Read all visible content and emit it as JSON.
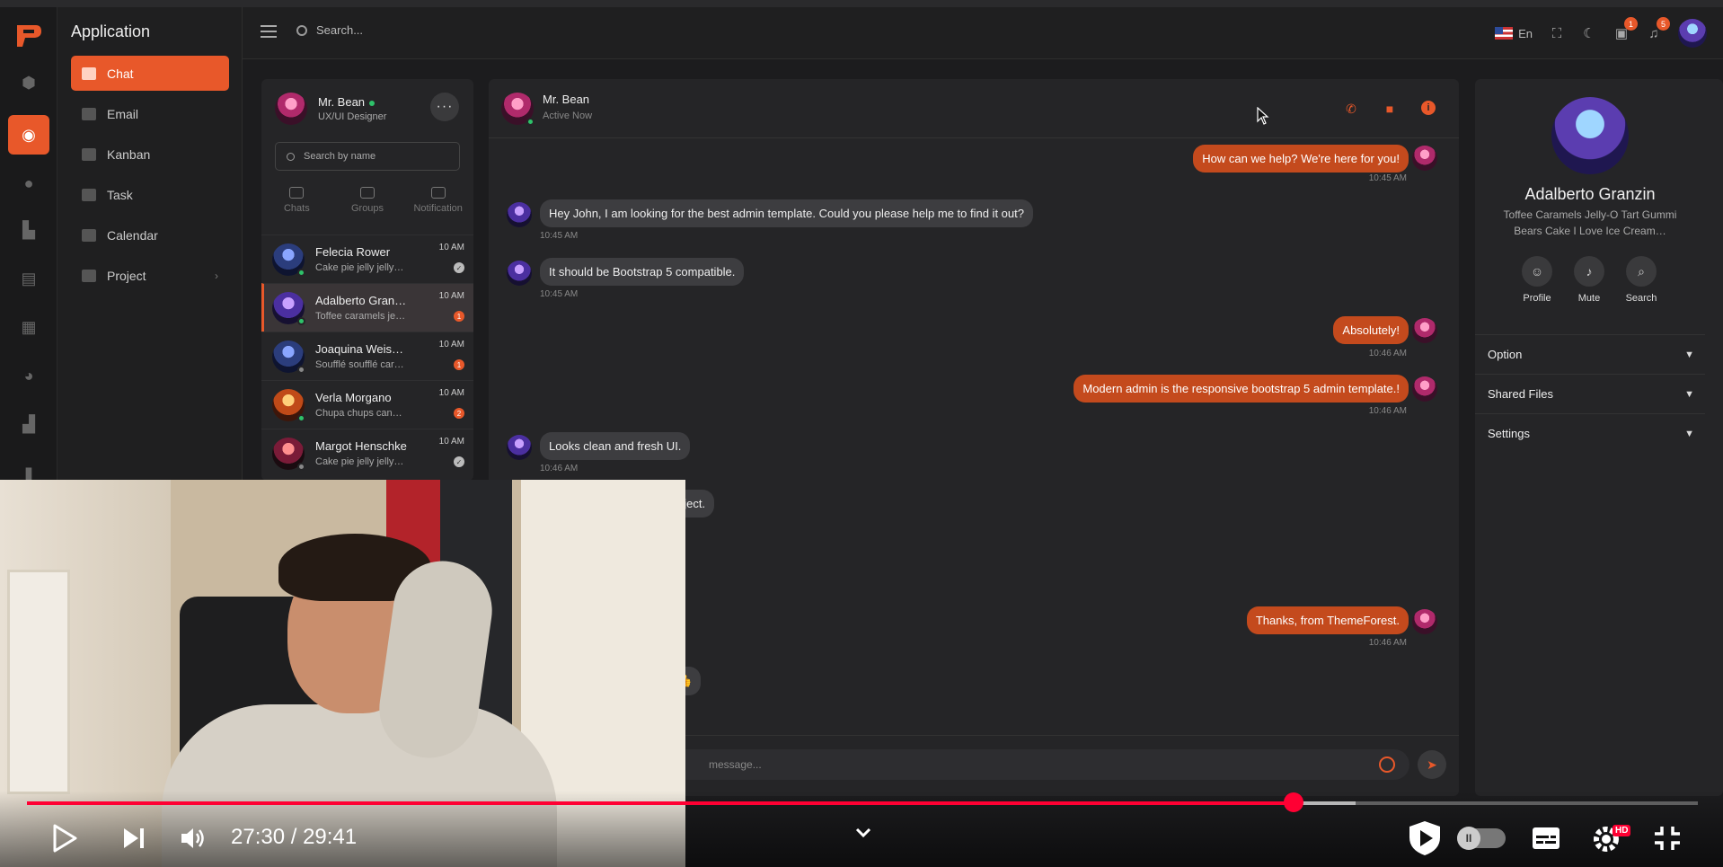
{
  "app": {
    "title": "Application"
  },
  "nav": {
    "items": [
      {
        "label": "Chat"
      },
      {
        "label": "Email"
      },
      {
        "label": "Kanban"
      },
      {
        "label": "Task"
      },
      {
        "label": "Calendar"
      },
      {
        "label": "Project"
      }
    ]
  },
  "header": {
    "search_placeholder": "Search...",
    "language": "En",
    "mail_badge": "1",
    "notif_badge": "5"
  },
  "me": {
    "name": "Mr. Bean",
    "role": "UX/UI Designer"
  },
  "contacts": {
    "search_placeholder": "Search by name",
    "tabs": [
      {
        "label": "Chats"
      },
      {
        "label": "Groups"
      },
      {
        "label": "Notification"
      }
    ],
    "list": [
      {
        "name": "Felecia Rower",
        "msg": "Cake pie jelly jelly…",
        "time": "10 AM",
        "badge": "✓"
      },
      {
        "name": "Adalberto Gran…",
        "msg": "Toffee caramels je…",
        "time": "10 AM",
        "badge": "1"
      },
      {
        "name": "Joaquina Weis…",
        "msg": "Soufflé soufflé car…",
        "time": "10 AM",
        "badge": "1"
      },
      {
        "name": "Verla Morgano",
        "msg": "Chupa chups can…",
        "time": "10 AM",
        "badge": "2"
      },
      {
        "name": "Margot Henschke",
        "msg": "Cake pie jelly jelly…",
        "time": "10 AM",
        "badge": "✓"
      }
    ]
  },
  "chat": {
    "header_name": "Mr. Bean",
    "header_status": "Active Now",
    "messages": [
      {
        "text": "How can we help? We're here for you!",
        "time": "10:45 AM"
      },
      {
        "text": "Hey John, I am looking for the best admin template. Could you please help me to find it out?",
        "time": "10:45 AM"
      },
      {
        "text": "It should be Bootstrap 5 compatible.",
        "time": "10:45 AM"
      },
      {
        "text": "Absolutely!",
        "time": "10:46 AM"
      },
      {
        "text": "Modern admin is the responsive bootstrap 5 admin template.!",
        "time": "10:46 AM"
      },
      {
        "text": "Looks clean and fresh UI.",
        "time": "10:46 AM"
      },
      {
        "text": "oject.",
        "time": ""
      },
      {
        "text": "Thanks, from ThemeForest.",
        "time": "10:46 AM"
      },
      {
        "text": "👍",
        "time": ""
      }
    ],
    "composer_placeholder": "message..."
  },
  "profile": {
    "name": "Adalberto Granzin",
    "bio": "Toffee Caramels Jelly-O Tart Gummi Bears Cake I Love Ice Cream…",
    "actions": [
      {
        "label": "Profile"
      },
      {
        "label": "Mute"
      },
      {
        "label": "Search"
      }
    ],
    "sections": [
      {
        "label": "Option"
      },
      {
        "label": "Shared Files"
      },
      {
        "label": "Settings"
      }
    ]
  },
  "video": {
    "timecode": "27:30 / 29:41",
    "progress": 0.758,
    "buffered": 0.795,
    "quality_badge": "HD"
  },
  "colors": {
    "accent": "#e8582a",
    "player_red": "#ff0033"
  }
}
